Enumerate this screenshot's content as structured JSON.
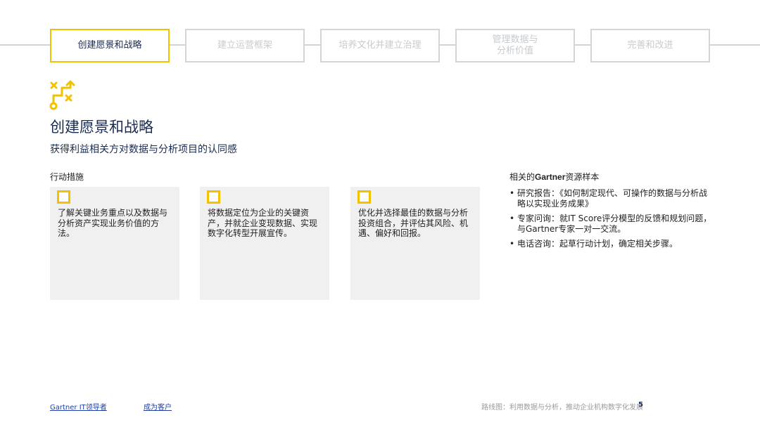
{
  "timeline": {
    "steps": [
      {
        "label": "创建愿景和战略"
      },
      {
        "label": "建立运营框架"
      },
      {
        "label": "培养文化并建立治理"
      },
      {
        "label": "管理数据与\n分析价值"
      },
      {
        "label": "完善和改进"
      }
    ],
    "active_index": 0
  },
  "header": {
    "icon": "strategy-icon",
    "title": "创建愿景和战略",
    "subtitle": "获得利益相关方对数据与分析项目的认同感"
  },
  "actions": {
    "label": "行动措施",
    "items": [
      {
        "text": "了解关键业务重点以及数据与分析资产实现业务价值的方法。"
      },
      {
        "text": "将数据定位为企业的关键资产，并就企业变现数据、实现数字化转型开展宣传。"
      },
      {
        "text": "优化并选择最佳的数据与分析投资组合，并评估其风险、机遇、偏好和回报。"
      }
    ]
  },
  "resources": {
    "title_prefix": "相关的",
    "title_brand": "Gartner",
    "title_suffix": "资源样本",
    "items": [
      {
        "text": "研究报告：《如何制定现代、可操作的数据与分析战略以实现业务成果》"
      },
      {
        "text": "专家问询：就IT Score评分模型的反馈和规划问题，与Gartner专家一对一交流。"
      },
      {
        "text": "电话咨询：起草行动计划，确定相关步骤。"
      }
    ],
    "bullet": "•"
  },
  "footer": {
    "link1": "Gartner IT领导者",
    "link2": "成为客户",
    "note": "路线图：利用数据与分析，推动企业机构数字化发展",
    "page": "5"
  },
  "colors": {
    "accent": "#f2c200",
    "navy": "#1a2b50",
    "card_bg": "#f0f0f0",
    "link": "#1f3fa8"
  }
}
